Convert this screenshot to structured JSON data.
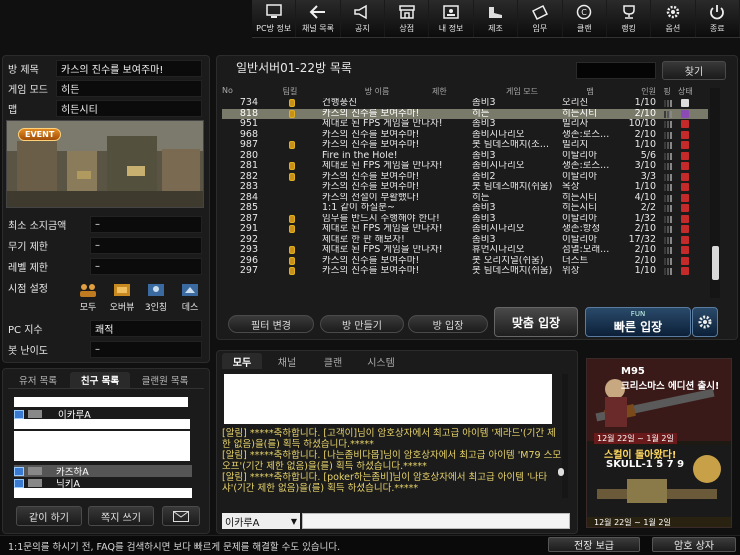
{
  "toolbar": {
    "items": [
      {
        "label": "PC방 정보",
        "icon": "monitor-icon"
      },
      {
        "label": "채널 목록",
        "icon": "back-arrow-icon"
      },
      {
        "label": "공지",
        "icon": "megaphone-icon"
      },
      {
        "label": "상점",
        "icon": "shop-icon"
      },
      {
        "label": "내 정보",
        "icon": "id-card-icon"
      },
      {
        "label": "제조",
        "icon": "boot-icon"
      },
      {
        "label": "임무",
        "icon": "ticket-icon"
      },
      {
        "label": "클랜",
        "icon": "clan-shield-icon"
      },
      {
        "label": "랭킹",
        "icon": "trophy-icon"
      },
      {
        "label": "옵션",
        "icon": "gear-icon"
      },
      {
        "label": "종료",
        "icon": "power-icon"
      }
    ]
  },
  "room_info": {
    "title_label": "방 제목",
    "title_value": "카스의 진수를 보여주마!",
    "mode_label": "게임 모드",
    "mode_value": "히든",
    "map_label": "맵",
    "map_value": "히든시티",
    "event_badge": "EVENT",
    "min_money_label": "최소 소지금액",
    "min_money_value": "–",
    "weapon_limit_label": "무기 제한",
    "weapon_limit_value": "–",
    "level_limit_label": "레벨 제한",
    "level_limit_value": "–",
    "view_label": "시점 설정",
    "view_options": [
      "모두",
      "오버뷰",
      "3인칭",
      "데스"
    ],
    "pc_index_label": "PC 지수",
    "pc_index_value": "쾌적",
    "bot_diff_label": "봇 난이도",
    "bot_diff_value": "–"
  },
  "friends": {
    "tabs": [
      "유저 목록",
      "친구 목록",
      "클랜원 목록"
    ],
    "active_tab": 1,
    "items": [
      "이카루A",
      "카즈하A",
      "닉키A"
    ],
    "buttons": [
      "같이 하기",
      "쪽지 쓰기"
    ]
  },
  "room_list": {
    "title": "일반서버01-22방 목록",
    "search_button": "찾기",
    "headers": [
      "No",
      "팀킬",
      "방 이름",
      "제한",
      "게임 모드",
      "맵",
      "인원",
      "핑",
      "상태"
    ],
    "rows": [
      {
        "num": "734",
        "lock": true,
        "name": "건행풍진",
        "mode": "좀비3",
        "map": "오리진",
        "count": "1/10",
        "status": "w"
      },
      {
        "num": "818",
        "lock": true,
        "name": "카스의 진수를 보여주마!",
        "mode": "히든",
        "map": "히든시티",
        "count": "2/10",
        "status": "p",
        "selected": true
      },
      {
        "num": "951",
        "lock": false,
        "name": "제대로 된 FPS 게임을 만나자!",
        "mode": "좀비3",
        "map": "빌리사",
        "count": "10/10",
        "status": "r"
      },
      {
        "num": "968",
        "lock": false,
        "name": "카스의 진수를 보여주마!",
        "mode": "좀비시나리오",
        "map": "생존:로스...",
        "count": "2/10",
        "status": "r"
      },
      {
        "num": "987",
        "lock": true,
        "name": "카스의 진수를 보여주마!",
        "mode": "봇 팀데스매치(조...",
        "map": "빌리지",
        "count": "1/10",
        "status": "r"
      },
      {
        "num": "280",
        "lock": false,
        "name": "Fire in the Hole!",
        "mode": "좀비3",
        "map": "이탈리아",
        "count": "5/6",
        "status": "r"
      },
      {
        "num": "281",
        "lock": true,
        "name": "제대로 된 FPS 게임을 만나자!",
        "mode": "좀비시나리오",
        "map": "생존:로스...",
        "count": "3/10",
        "status": "r"
      },
      {
        "num": "282",
        "lock": true,
        "name": "카스의 진수를 보여주마!",
        "mode": "좀비2",
        "map": "이탈리아",
        "count": "3/3",
        "status": "r"
      },
      {
        "num": "283",
        "lock": false,
        "name": "카스의 진수를 보여주마!",
        "mode": "봇 팀데스매치(쉬움)",
        "map": "옥상",
        "count": "1/10",
        "status": "r"
      },
      {
        "num": "284",
        "lock": false,
        "name": "카스의 전설이 부활했다!",
        "mode": "히든",
        "map": "히든시티",
        "count": "4/10",
        "status": "r"
      },
      {
        "num": "285",
        "lock": false,
        "name": "1:1 같이 하실분~",
        "mode": "좀비3",
        "map": "히든시티",
        "count": "2/2",
        "status": "r"
      },
      {
        "num": "287",
        "lock": true,
        "name": "임무를 반드시 수행해야 한다!",
        "mode": "좀비3",
        "map": "이탈리아",
        "count": "1/32",
        "status": "r"
      },
      {
        "num": "291",
        "lock": true,
        "name": "제대로 된 FPS 게임을 만나자!",
        "mode": "좀비시나리오",
        "map": "생존:항정",
        "count": "2/10",
        "status": "r"
      },
      {
        "num": "292",
        "lock": false,
        "name": "제대로 한 판 해보자!",
        "mode": "좀비3",
        "map": "이탈리아",
        "count": "17/32",
        "status": "r"
      },
      {
        "num": "293",
        "lock": true,
        "name": "제대로 된 FPS 게임을 만나자!",
        "mode": "휴먼시나리오",
        "map": "섬멸:모래...",
        "count": "2/10",
        "status": "r"
      },
      {
        "num": "296",
        "lock": true,
        "name": "카스의 진수를 보여주마!",
        "mode": "봇 오리지널(쉬움)",
        "map": "더스트",
        "count": "2/10",
        "status": "r"
      },
      {
        "num": "297",
        "lock": true,
        "name": "카스의 진수를 보여주마!",
        "mode": "봇 팀데스매치(쉬움)",
        "map": "위장",
        "count": "1/10",
        "status": "r"
      }
    ],
    "buttons": [
      "필터 변경",
      "방 만들기",
      "방 입장"
    ],
    "match_button": "맞춤 입장",
    "quick_top": "FUN",
    "quick_button": "빠른 입장"
  },
  "chat": {
    "tabs": [
      "모두",
      "채널",
      "클랜",
      "시스템"
    ],
    "messages": [
      "[알림] *****축하합니다. [고객이]님이 암호상자에서 최고급 아이템 '제라드'(기간 제한 없음)을(를) 획득 하셨습니다.*****",
      "[알림] *****축하합니다. [나는좀비다몹]님이 암호상자에서 최고급 아이템 'M79 스모오프'(기간 제한 없음)을(를) 획득 하셨습니다.*****",
      "[알림] *****축하합니다. [poker하는좀비]님이 암호상자에서 최고급 아이템 '나타샤'(기간 제한 없음)을(를) 획득 하셨습니다.*****"
    ],
    "selector": "이카루A"
  },
  "ad": {
    "line1": "M95",
    "line2": "크리스마스 에디션 출시!",
    "date1": "12월 22일 ~ 1월 2일",
    "line3": "스컬이 돌아왔다!",
    "line4": "SKULL-1 5 7 9",
    "date2": "12월 22일 ~ 1월 2일"
  },
  "footer": {
    "text": "1:1문의를 하시기 전, FAQ를 검색하시면 보다 빠르게 문제를 해결할 수도 있습니다.",
    "buttons": [
      "전장 보급",
      "암호 상자"
    ]
  }
}
